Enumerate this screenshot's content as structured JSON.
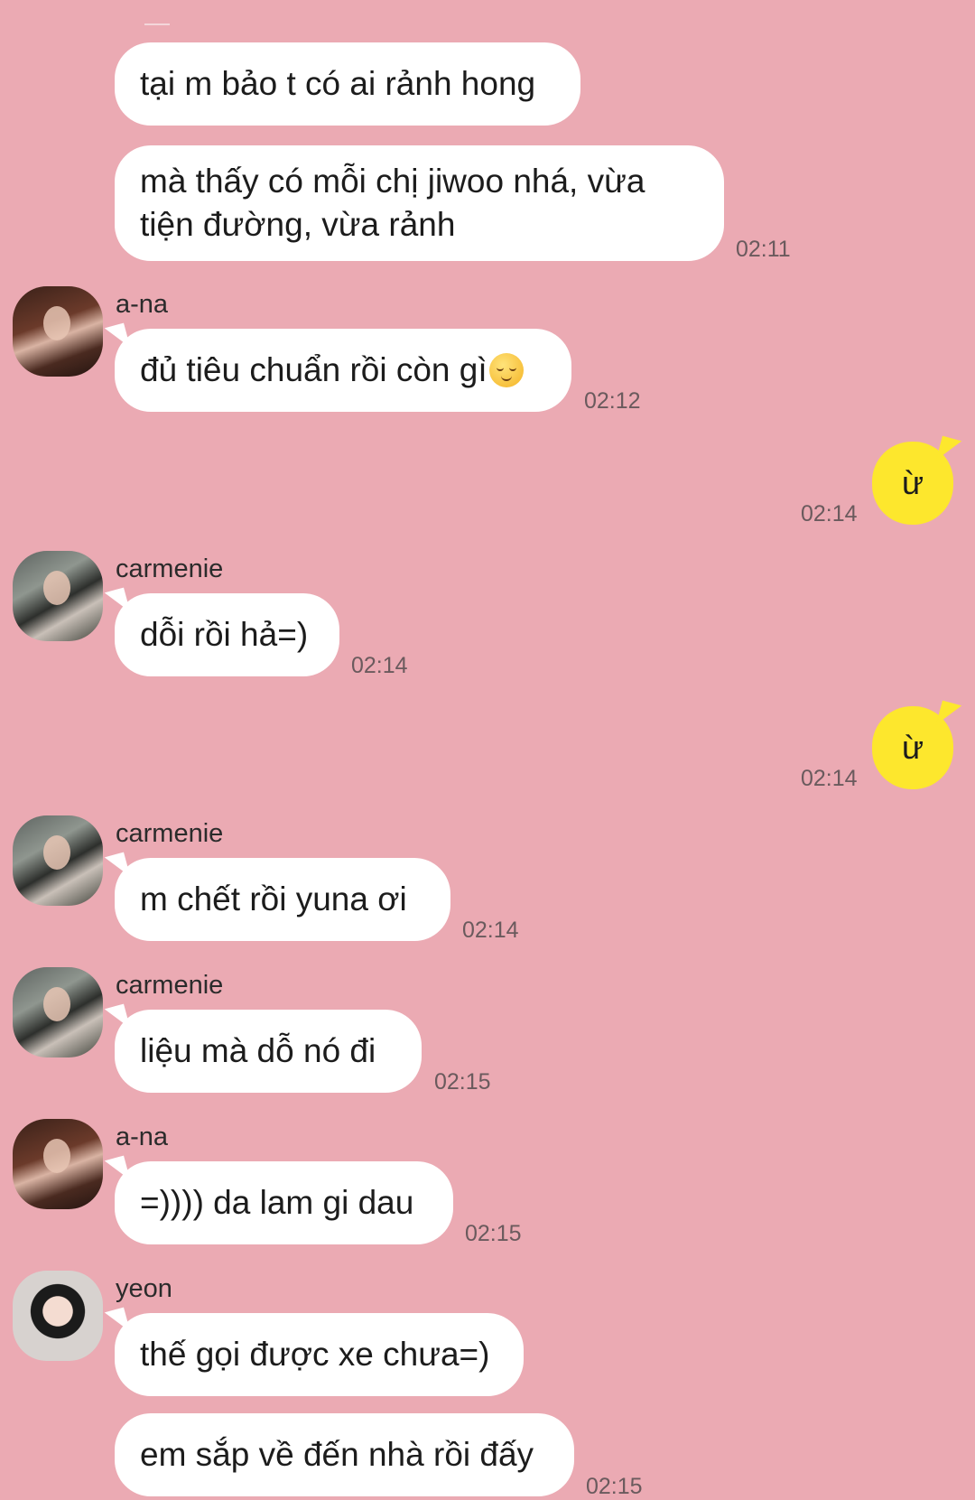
{
  "messages": [
    {
      "sender": "",
      "text": "tại m bảo t có ai rảnh hong",
      "time": ""
    },
    {
      "sender": "",
      "text": "mà thấy có mỗi chị jiwoo nhá, vừa tiện đường, vừa rảnh",
      "time": "02:11"
    },
    {
      "sender": "a-na",
      "text": "đủ tiêu chuẩn rồi còn gì",
      "emoji": "relieved-face-emoji",
      "time": "02:12"
    },
    {
      "sender": "me",
      "text": "ừ",
      "time": "02:14"
    },
    {
      "sender": "carmenie",
      "text": "dỗi rồi hả=)",
      "time": "02:14"
    },
    {
      "sender": "me",
      "text": "ừ",
      "time": "02:14"
    },
    {
      "sender": "carmenie",
      "text": "m chết rồi yuna  ơi",
      "time": "02:14"
    },
    {
      "sender": "carmenie",
      "text": "liệu mà dỗ nó đi",
      "time": "02:15"
    },
    {
      "sender": "a-na",
      "text": "=)))) da lam gi dau",
      "time": "02:15"
    },
    {
      "sender": "yeon",
      "text": "thế gọi được xe chưa=)",
      "time": ""
    },
    {
      "sender": "yeon",
      "text": "em sắp về đến nhà rồi đấy",
      "time": "02:15"
    }
  ],
  "colors": {
    "background": "#ebaab3",
    "incoming_bubble": "#ffffff",
    "outgoing_bubble": "#fde72d"
  }
}
